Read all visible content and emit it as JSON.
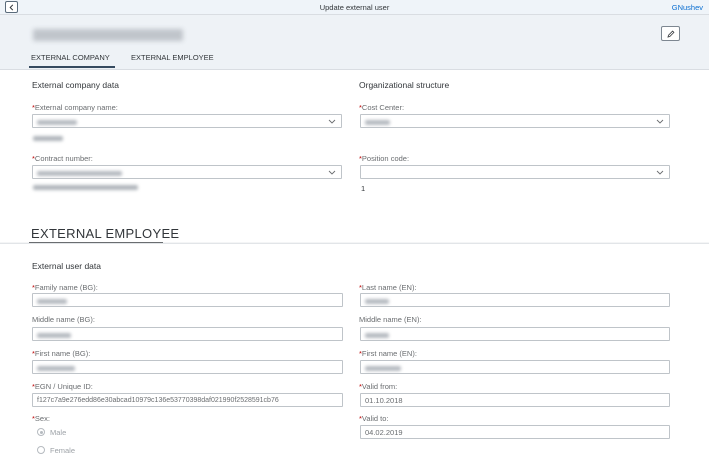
{
  "topbar": {
    "title": "Update external user",
    "user": "GNushev"
  },
  "tabs": [
    "EXTERNAL COMPANY",
    "EXTERNAL EMPLOYEE"
  ],
  "company": {
    "group_title": "External company data",
    "company_name_label": "External company name:",
    "contract_label": "Contract number:"
  },
  "org": {
    "group_title": "Organizational structure",
    "cost_center_label": "Cost Center:",
    "position_code_label": "Position code:",
    "position_code_value": "1"
  },
  "employee": {
    "section_title": "EXTERNAL EMPLOYEE",
    "group_title": "External user data",
    "family_name_bg_label": "Family name (BG):",
    "middle_name_bg_label": "Middle name (BG):",
    "first_name_bg_label": "First name (BG):",
    "egn_label": "EGN / Unique ID:",
    "egn_value": "f127c7a9e276edd86e30abcad10979c136e53770398daf021990f2528591cb76",
    "sex_label": "Sex:",
    "sex_options": [
      "Male",
      "Female"
    ],
    "last_name_en_label": "Last name (EN):",
    "middle_name_en_label": "Middle name (EN):",
    "first_name_en_label": "First name (EN):",
    "valid_from_label": "Valid from:",
    "valid_from_value": "01.10.2018",
    "valid_to_label": "Valid to:",
    "valid_to_value": "04.02.2019"
  },
  "icons": {
    "back": "back-icon",
    "edit": "pencil-icon",
    "dropdown": "chevron-down-icon",
    "radio": "radio-icon"
  },
  "colors": {
    "required": "#bb0000",
    "link": "#0a6ed1",
    "field_border": "#bfc4c9"
  }
}
